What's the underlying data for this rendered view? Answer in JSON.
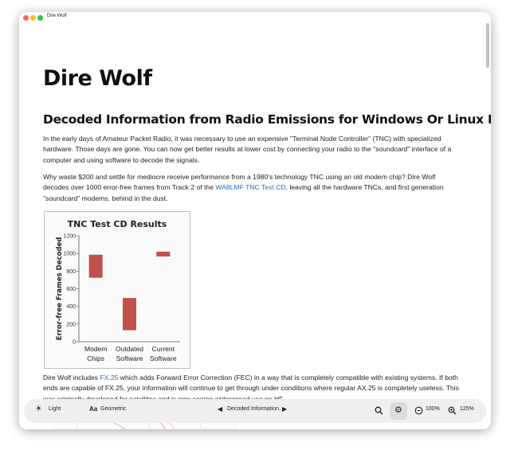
{
  "window": {
    "title": "Dire Wolf"
  },
  "page": {
    "title": "Dire Wolf",
    "subtitle": "Decoded Information from Radio Emissions for Windows Or Linux Fans",
    "para1": "In the early days of Amateur Packet Radio, it was necessary to use an expensive \"Terminal Node Controller\" (TNC) with specialized hardware. Those days are gone. You can now get better results at lower cost by connecting your radio to the \"soundcard\" interface of a computer and using software to decode the signals.",
    "para2_a": "Why waste $200 and settle for mediocre receive performance from a 1980's technology TNC using an old modem chip? Dire Wolf decodes over 1000 error-free frames from Track 2 of the ",
    "para2_link": "WA8LMF TNC Test CD",
    "para2_b": ", leaving all the hardware TNCs, and first generation \"soundcard\" modems, behind in the dust.",
    "para3_a": "Dire Wolf includes ",
    "para3_link": "FX.25",
    "para3_b": " which adds Forward Error Correction (FEC) in a way that is completely compatible with existing systems. If both ends are capable of FX.25, your information will continue to get through under conditions where regular AX.25 is completely useless. This was originally developed for satellites and is now seeing widespread use on HF."
  },
  "chart_data": {
    "type": "bar",
    "title": "TNC Test  CD  Results",
    "ylabel": "Error-free  Frames Decoded",
    "ylim": [
      0,
      1200
    ],
    "yticks": [
      "0",
      "200",
      "400",
      "600",
      "800",
      "1000",
      "1200"
    ],
    "categories": [
      "Modem\nChips",
      "Outdated\nSoftware",
      "Current\nSoftware"
    ],
    "ranges": [
      [
        725,
        985
      ],
      [
        130,
        495
      ],
      [
        965,
        1020
      ]
    ],
    "bar_color": "#c0504d"
  },
  "toolbar": {
    "theme_label": "Light",
    "font_label": "Geometric",
    "font_icon_text": "Aa",
    "section_label": "Decoded Information...",
    "zoom_reset_label": "100%",
    "zoom_label": "125%"
  }
}
